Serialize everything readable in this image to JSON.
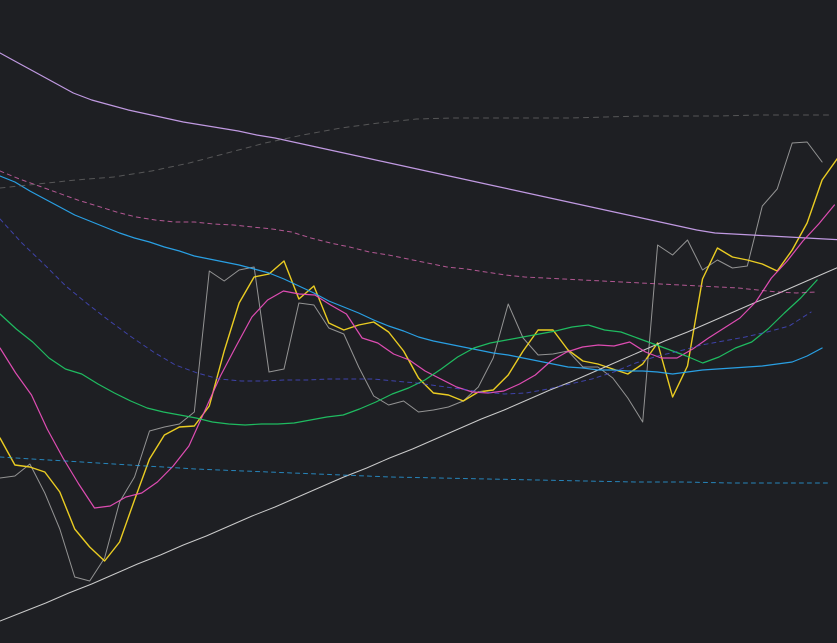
{
  "chart_data": {
    "type": "line",
    "title": "",
    "xlabel": "",
    "ylabel": "",
    "background": "#1e1f23",
    "grid": false,
    "legend": "none",
    "x": [
      0,
      1,
      2,
      3,
      4,
      5,
      6,
      7,
      8,
      9,
      10,
      11,
      12,
      13,
      14,
      15,
      16,
      17,
      18,
      19,
      20,
      21,
      22,
      23,
      24,
      25,
      26,
      27,
      28,
      29,
      30,
      31,
      32,
      33,
      34,
      35,
      36,
      37,
      38,
      39,
      40,
      41,
      42,
      43,
      44,
      45,
      46,
      47,
      48,
      49,
      50,
      51,
      52,
      53,
      54,
      55,
      56,
      57,
      58,
      59,
      60,
      61,
      62,
      63,
      64,
      65,
      66,
      67,
      68,
      69,
      70,
      71,
      72,
      73,
      74,
      75,
      76,
      77,
      78,
      79,
      80,
      81
    ],
    "xlim": [
      0,
      84
    ],
    "ylim": [
      0,
      643
    ],
    "series": [
      {
        "color": "#9a9a9a",
        "width": 1,
        "dash": "",
        "values": [
          165,
          167,
          179,
          150,
          114,
          66,
          62,
          85,
          141,
          166,
          212,
          216,
          219,
          231,
          372,
          362,
          373,
          376,
          271,
          274,
          340,
          338,
          315,
          309,
          276,
          247,
          238,
          242,
          231,
          233,
          236,
          242,
          256,
          285,
          339,
          305,
          288,
          289,
          292,
          276,
          276,
          265,
          245,
          221,
          398,
          388,
          403,
          373,
          383,
          375,
          377,
          437,
          454,
          500,
          501,
          481
        ]
      },
      {
        "color": "#f5d623",
        "width": 1.4,
        "dash": "",
        "values": [
          205,
          178,
          176,
          171,
          151,
          114,
          96,
          82,
          101,
          143,
          184,
          208,
          216,
          217,
          237,
          292,
          340,
          366,
          369,
          382,
          344,
          357,
          320,
          313,
          318,
          321,
          311,
          292,
          265,
          250,
          248,
          242,
          251,
          253,
          268,
          292,
          313,
          313,
          293,
          282,
          279,
          274,
          269,
          279,
          300,
          246,
          277,
          364,
          395,
          386,
          383,
          379,
          372,
          393,
          420,
          463,
          484,
          495
        ]
      },
      {
        "color": "#d4d4d4",
        "width": 1,
        "dash": "",
        "values": [
          22,
          31,
          40,
          50,
          59,
          69,
          79,
          88,
          98,
          107,
          117,
          127,
          136,
          146,
          156,
          166,
          175,
          185,
          194,
          204,
          214,
          224,
          233,
          243,
          253,
          262,
          272,
          282,
          292,
          302,
          311,
          321,
          331,
          341,
          350,
          360,
          370,
          380
        ]
      },
      {
        "color": "#c9a0ec",
        "width": 1.2,
        "dash": "",
        "values": [
          590,
          580,
          570,
          560,
          550,
          543,
          538,
          533,
          529,
          525,
          521,
          518,
          515,
          512,
          508,
          505,
          501,
          497,
          493,
          489,
          485,
          481,
          477,
          473,
          469,
          465,
          461,
          457,
          453,
          449,
          445,
          441,
          437,
          433,
          429,
          425,
          421,
          417,
          413,
          410,
          409,
          408,
          407,
          406,
          405,
          404,
          403
        ]
      },
      {
        "color": "#2aa7ee",
        "width": 1.2,
        "dash": "",
        "values": [
          467,
          461,
          452,
          444,
          436,
          428,
          422,
          416,
          410,
          405,
          401,
          396,
          392,
          387,
          384,
          381,
          378,
          374,
          370,
          364,
          357,
          350,
          342,
          336,
          330,
          323,
          317,
          312,
          306,
          302,
          299,
          296,
          293,
          290,
          288,
          285,
          282,
          279,
          276,
          275,
          273,
          273,
          272,
          272,
          271,
          269,
          271,
          273,
          274,
          275,
          276,
          277,
          279,
          281,
          287,
          295
        ]
      },
      {
        "color": "#e94fbb",
        "width": 1.2,
        "dash": "",
        "values": [
          295,
          270,
          248,
          214,
          185,
          159,
          135,
          137,
          146,
          150,
          161,
          177,
          197,
          232,
          267,
          297,
          326,
          343,
          352,
          349,
          348,
          338,
          329,
          305,
          300,
          289,
          283,
          272,
          264,
          256,
          251,
          250,
          252,
          259,
          268,
          282,
          291,
          296,
          298,
          297,
          301,
          291,
          285,
          285,
          294,
          305,
          315,
          325,
          341,
          365,
          382,
          402,
          419,
          438
        ]
      },
      {
        "color": "#20c464",
        "width": 1.2,
        "dash": "",
        "values": [
          329,
          314,
          301,
          285,
          274,
          269,
          259,
          250,
          242,
          235,
          231,
          228,
          225,
          221,
          219,
          218,
          219,
          219,
          220,
          223,
          226,
          228,
          234,
          241,
          249,
          255,
          263,
          274,
          286,
          295,
          300,
          303,
          306,
          309,
          312,
          316,
          318,
          313,
          311,
          305,
          299,
          293,
          287,
          280,
          286,
          295,
          301,
          314,
          330,
          345,
          363
        ]
      },
      {
        "color": "#e46bb8",
        "width": 1,
        "dash": "4 4",
        "values": [
          472,
          464,
          457,
          450,
          443,
          437,
          431,
          426,
          423,
          421,
          421,
          419,
          418,
          416,
          414,
          411,
          405,
          400,
          396,
          391,
          388,
          384,
          380,
          376,
          374,
          371,
          368,
          366,
          365,
          364,
          363,
          362,
          361,
          360,
          359,
          358,
          357,
          356,
          355,
          353,
          351,
          350,
          351
        ]
      },
      {
        "color": "#6a6a6a",
        "width": 1,
        "dash": "5 5",
        "values": [
          455,
          459,
          463,
          466,
          472,
          480,
          490,
          500,
          508,
          515,
          520,
          524,
          525,
          525,
          525,
          525,
          526,
          527,
          527,
          527,
          528,
          528,
          528
        ]
      },
      {
        "color": "#4a4fd6",
        "width": 1,
        "dash": "4 4",
        "values": [
          424,
          400,
          379,
          357,
          339,
          322,
          306,
          291,
          278,
          270,
          264,
          262,
          262,
          263,
          263,
          264,
          264,
          264,
          262,
          260,
          257,
          254,
          251,
          249,
          250,
          254,
          259,
          264,
          271,
          280,
          287,
          292,
          298,
          302,
          306,
          311,
          317,
          331
        ]
      },
      {
        "color": "#2aa7ee",
        "width": 1,
        "dash": "4 4",
        "values": [
          186,
          183,
          180,
          177,
          174,
          172,
          170,
          168,
          166,
          165,
          164,
          163,
          162,
          161,
          161,
          160,
          160,
          160
        ]
      }
    ]
  }
}
